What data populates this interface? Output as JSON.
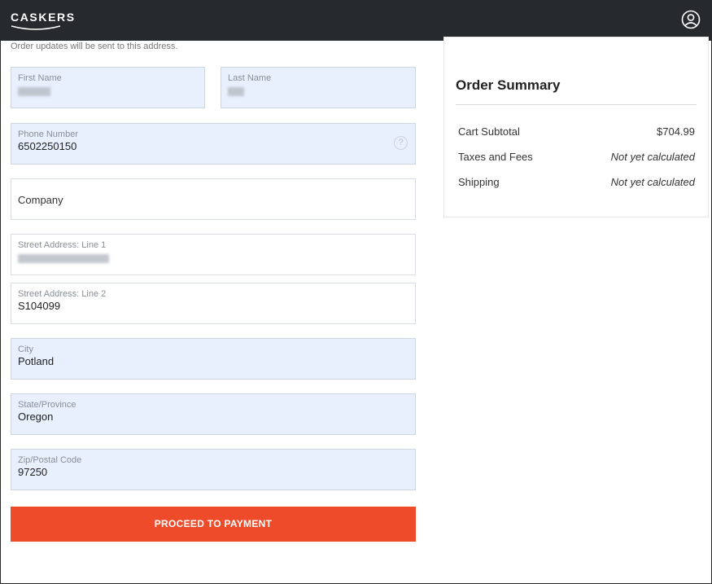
{
  "header": {
    "logo_text": "CASKERS",
    "user_icon": "user-account-icon"
  },
  "form": {
    "notice": "Order updates will be sent to this address.",
    "first_name": {
      "label": "First Name",
      "value": ""
    },
    "last_name": {
      "label": "Last Name",
      "value": ""
    },
    "phone": {
      "label": "Phone Number",
      "value": "6502250150",
      "help_glyph": "?"
    },
    "company": {
      "placeholder": "Company"
    },
    "street1": {
      "label": "Street Address: Line 1",
      "value": ""
    },
    "street2": {
      "label": "Street Address: Line 2",
      "value": "S104099"
    },
    "city": {
      "label": "City",
      "value": "Potland"
    },
    "state": {
      "label": "State/Province",
      "value": "Oregon"
    },
    "zip": {
      "label": "Zip/Postal Code",
      "value": "97250"
    },
    "submit_label": "PROCEED TO PAYMENT"
  },
  "summary": {
    "title": "Order Summary",
    "rows": [
      {
        "label": "Cart Subtotal",
        "value": "$704.99"
      },
      {
        "label": "Taxes and Fees",
        "value": "Not yet calculated"
      },
      {
        "label": "Shipping",
        "value": "Not yet calculated"
      }
    ]
  },
  "colors": {
    "header_bg": "#272a2d",
    "autofill_bg": "#e8f0fe",
    "cta_bg": "#ee4b2b"
  }
}
